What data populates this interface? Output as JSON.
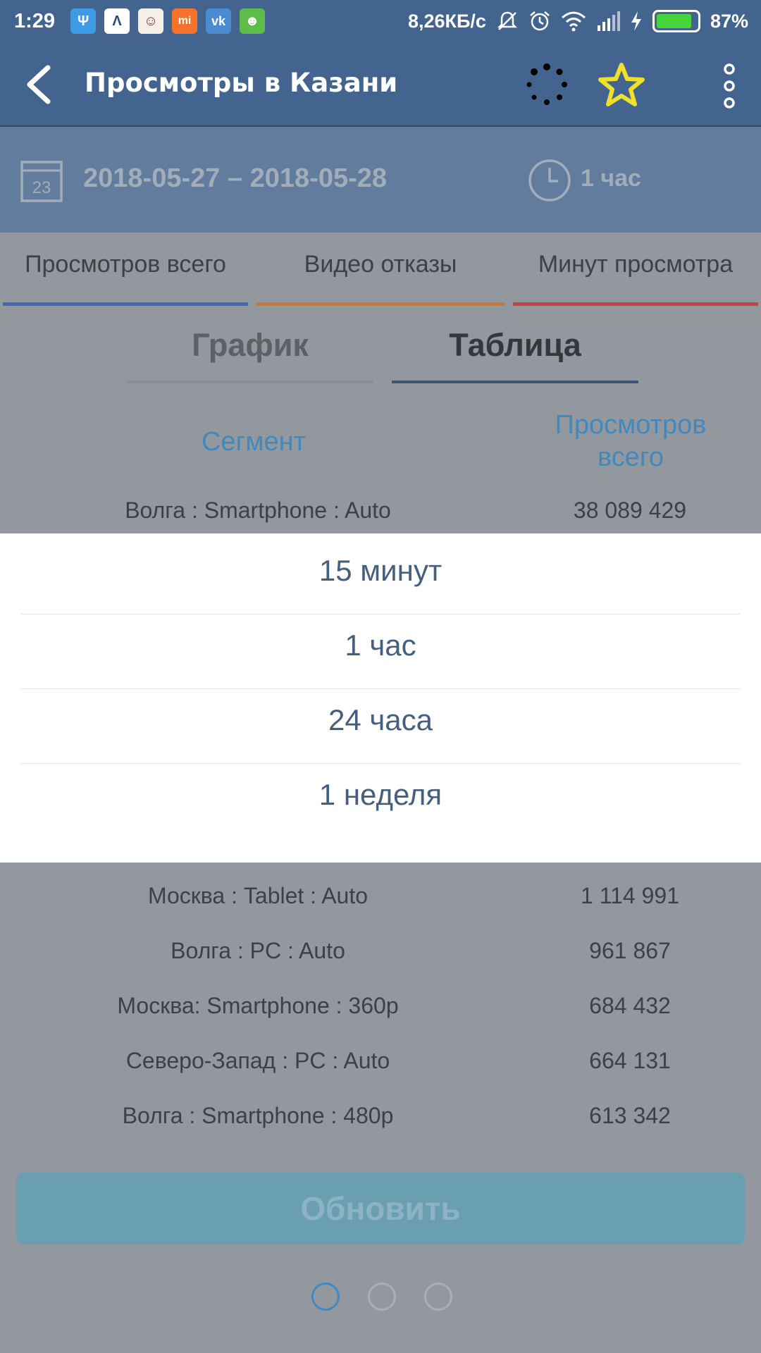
{
  "status_bar": {
    "time": "1:29",
    "apps": [
      {
        "icon": "usb-icon",
        "glyph": "Ψ",
        "color": "#3d9be4"
      },
      {
        "icon": "arrow-up-icon",
        "glyph": "Λ",
        "color": "#ffffff"
      },
      {
        "icon": "app-face-icon",
        "glyph": "☺",
        "color": "#ffffff"
      },
      {
        "icon": "mi-icon",
        "glyph": "mi",
        "color": "#f5722b"
      },
      {
        "icon": "vk-icon",
        "glyph": "vk",
        "color": "#4c8bd0"
      },
      {
        "icon": "android-icon",
        "glyph": "☻",
        "color": "#5dbc4a"
      }
    ],
    "net_speed": "8,26КБ/с",
    "battery_percent": "87%",
    "battery_level": 0.87
  },
  "app_bar": {
    "title": "Просмотры в Казани"
  },
  "date_bar": {
    "calendar_day": "23",
    "date_range": "2018-05-27 – 2018-05-28",
    "interval": "1 час"
  },
  "metric_tabs": [
    {
      "label": "Просмотров всего",
      "color": "#3f6bb3"
    },
    {
      "label": "Видео отказы",
      "color": "#c7792f"
    },
    {
      "label": "Минут просмотра",
      "color": "#c94343"
    }
  ],
  "view_tabs": {
    "chart_label": "График",
    "table_label": "Таблица",
    "active": "table"
  },
  "table": {
    "segment_header": "Сегмент",
    "views_header_line1": "Просмотров",
    "views_header_line2": "всего",
    "rows": [
      {
        "segment": "Волга : Smartphone : Auto",
        "value": "38 089 429"
      },
      {
        "segment": "Москва : Tablet : Auto",
        "value": "1 114 991"
      },
      {
        "segment": "Волга : PC : Auto",
        "value": "961 867"
      },
      {
        "segment": "Москва: Smartphone : 360p",
        "value": "684 432"
      },
      {
        "segment": "Северо-Запад : PC : Auto",
        "value": "664 131"
      },
      {
        "segment": "Волга : Smartphone : 480p",
        "value": "613 342"
      }
    ]
  },
  "refresh_label": "Обновить",
  "pager": {
    "count": 3,
    "active": 0
  },
  "interval_popup": {
    "options": [
      "15 минут",
      "1 час",
      "24 часа",
      "1 неделя"
    ]
  },
  "colors": {
    "app_bar": "#42648f",
    "accent_blue": "#3f89c0",
    "star": "#f0e02b"
  }
}
